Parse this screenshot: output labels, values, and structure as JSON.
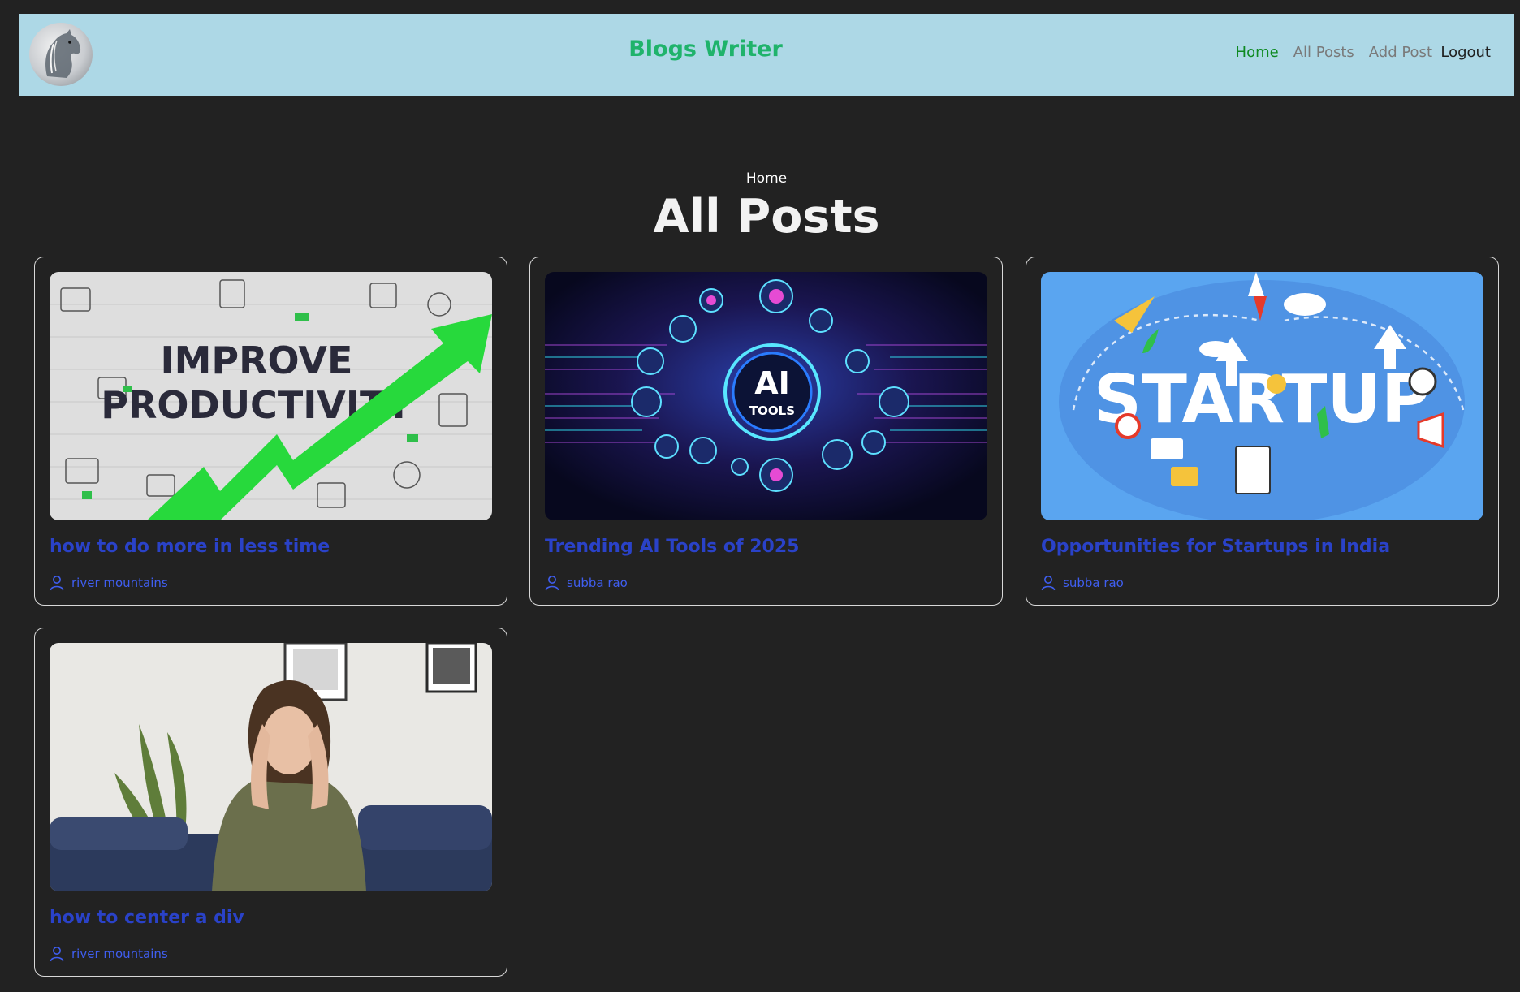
{
  "header": {
    "brand": "Blogs Writer",
    "nav": [
      "Home",
      "All Posts",
      "Add Post"
    ],
    "logout": "Logout",
    "logo_icon": "horse-head-icon",
    "active_color": "#0e8a22"
  },
  "page": {
    "breadcrumb": "Home",
    "title": "All Posts"
  },
  "posts": [
    {
      "title": "how to do more in less time",
      "author": "river mountains",
      "thumbnail": {
        "headline": [
          "IMPROVE",
          "PRODUCTIVITY"
        ]
      }
    },
    {
      "title": "Trending AI Tools of 2025",
      "author": "subba rao",
      "thumbnail": {
        "headline": [
          "AI",
          "TOOLS"
        ]
      }
    },
    {
      "title": "Opportunities for Startups in India",
      "author": "subba rao",
      "thumbnail": {
        "headline": [
          "STARTUP"
        ]
      }
    },
    {
      "title": "how to center a div",
      "author": "river mountains",
      "thumbnail": {
        "headline": []
      }
    }
  ],
  "colors": {
    "background": "#222222",
    "navbar": "#add8e6",
    "brand": "#1fb36b",
    "post_title": "#2a42c8",
    "author": "#3f5ef0"
  }
}
